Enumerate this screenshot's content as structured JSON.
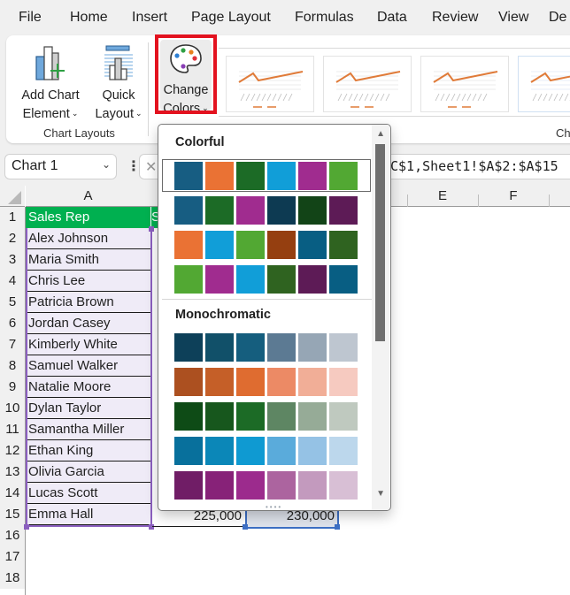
{
  "menu": {
    "tabs": [
      "File",
      "Home",
      "Insert",
      "Page Layout",
      "Formulas",
      "Data",
      "Review",
      "View",
      "De"
    ]
  },
  "ribbon": {
    "add_chart_element": [
      "Add Chart",
      "Element"
    ],
    "quick_layout": [
      "Quick",
      "Layout"
    ],
    "change_colors": [
      "Change",
      "Colors"
    ],
    "chart_layouts_group": "Chart Layouts",
    "chart_styles_group_partial": "Ch",
    "chevron": "⌄"
  },
  "formula_bar": {
    "name_box": "Chart 1",
    "formula_partial": "C$1,Sheet1!$A$2:$A$15"
  },
  "sheet": {
    "columns": [
      "A",
      "E",
      "F"
    ],
    "rows": [
      "1",
      "2",
      "3",
      "4",
      "5",
      "6",
      "7",
      "8",
      "9",
      "10",
      "11",
      "12",
      "13",
      "14",
      "15",
      "16",
      "17",
      "18"
    ],
    "header_A1": "Sales Rep",
    "header_B1_partial": "S",
    "sales_reps": [
      "Alex Johnson",
      "Maria Smith",
      "Chris Lee",
      "Patricia Brown",
      "Jordan Casey",
      "Kimberly White",
      "Samuel Walker",
      "Natalie Moore",
      "Dylan Taylor",
      "Samantha Miller",
      "Ethan King",
      "Olivia Garcia",
      "Lucas Scott",
      "Emma Hall"
    ],
    "row15_values": [
      "225,000",
      "230,000"
    ]
  },
  "color_panel": {
    "colorful_label": "Colorful",
    "monochromatic_label": "Monochromatic",
    "colorful": [
      [
        "#175d82",
        "#ea7234",
        "#1c6b26",
        "#119ed8",
        "#a02c8f",
        "#52a833"
      ],
      [
        "#175d82",
        "#1c6b26",
        "#a02c8f",
        "#0d3a52",
        "#124417",
        "#5d1b56"
      ],
      [
        "#ea7234",
        "#119ed8",
        "#52a833",
        "#953f10",
        "#085e83",
        "#2f6320"
      ],
      [
        "#52a833",
        "#a02c8f",
        "#119ed8",
        "#2f6320",
        "#5d1b56",
        "#085e83"
      ]
    ],
    "monochromatic": [
      [
        "#0d4059",
        "#115069",
        "#155e7e",
        "#5c7a93",
        "#96a6b5",
        "#bec6d0"
      ],
      [
        "#ac5020",
        "#c55f28",
        "#df6c30",
        "#ec8a65",
        "#f1ae97",
        "#f6cac0"
      ],
      [
        "#0e4b16",
        "#17571d",
        "#1c6b26",
        "#5e8663",
        "#96ab97",
        "#bfc9bf"
      ],
      [
        "#08709c",
        "#0b87b8",
        "#0f9ad2",
        "#5aabdb",
        "#95c2e5",
        "#bcd7ec"
      ],
      [
        "#701d66",
        "#872278",
        "#9c2b8d",
        "#ac649f",
        "#c39abe",
        "#d8bfd5"
      ]
    ],
    "selected_row": 0
  }
}
